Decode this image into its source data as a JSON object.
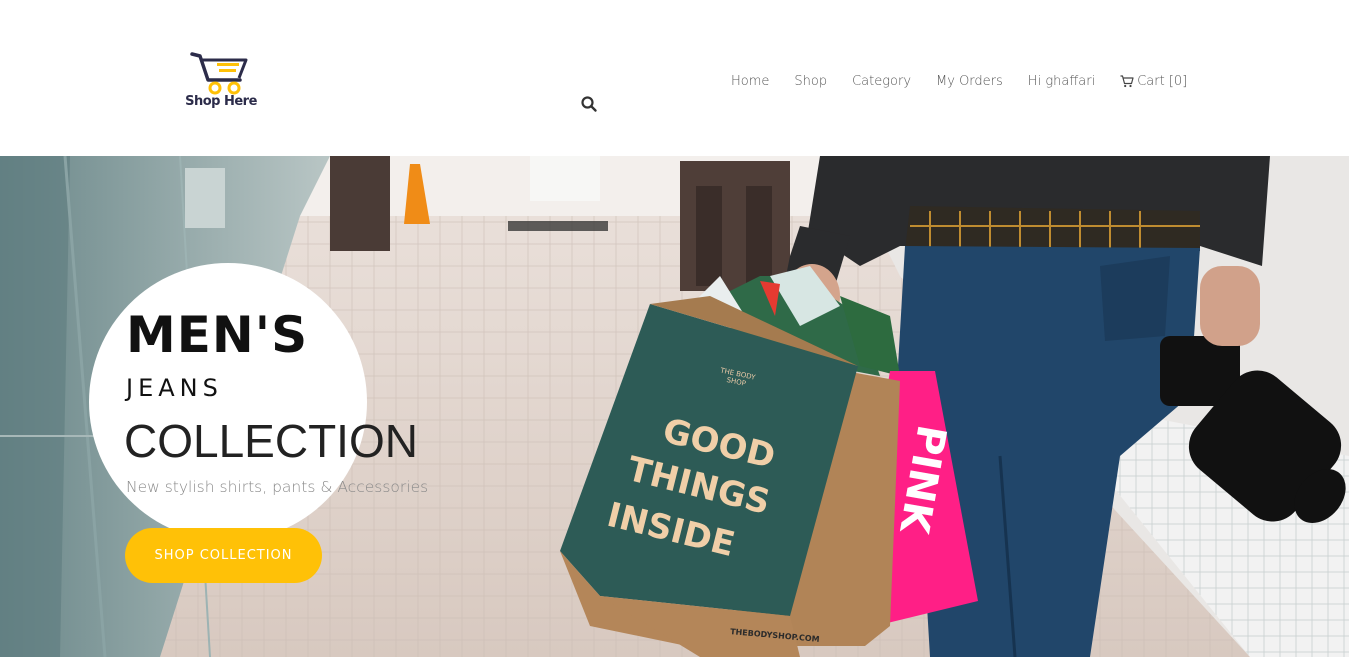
{
  "brand": {
    "logo_text": "Shop Here",
    "accent": "#ffc107",
    "logo_color": "#2c2c4a"
  },
  "header": {
    "search_icon": "search-icon"
  },
  "nav": {
    "items": [
      {
        "label": "Home"
      },
      {
        "label": "Shop"
      },
      {
        "label": "Category"
      },
      {
        "label": "My Orders"
      },
      {
        "label": "Hi ghaffari"
      }
    ],
    "cart": {
      "label": "Cart [0]",
      "icon": "cart-icon"
    }
  },
  "hero": {
    "title": "MEN'S",
    "subtitle": "JEANS",
    "collection": "COLLECTION",
    "tagline": "New stylish shirts, pants & Accessories",
    "cta": "SHOP COLLECTION",
    "bag_text_1": "GOOD",
    "bag_text_2": "THINGS",
    "bag_text_3": "INSIDE",
    "bag_brand": "THE BODY SHOP",
    "bag_footer": "THEBODYSHOP.COM",
    "pink_bag_text": "PINK"
  }
}
